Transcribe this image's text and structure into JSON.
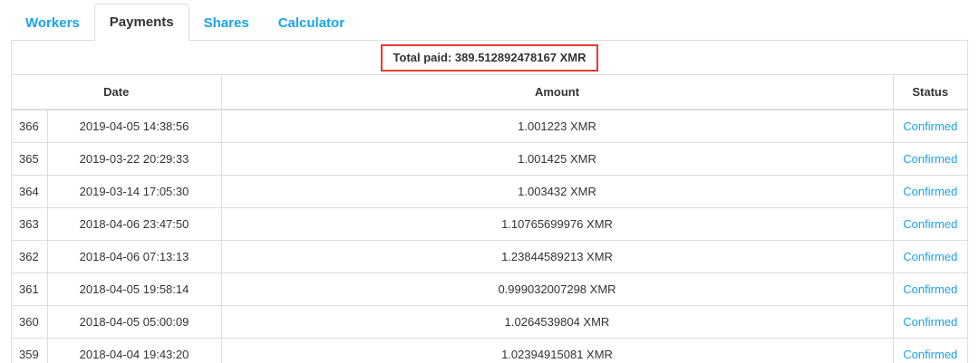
{
  "tabs": [
    {
      "label": "Workers",
      "active": false
    },
    {
      "label": "Payments",
      "active": true
    },
    {
      "label": "Shares",
      "active": false
    },
    {
      "label": "Calculator",
      "active": false
    }
  ],
  "total_paid": "Total paid: 389.512892478167 XMR",
  "table": {
    "headers": {
      "date": "Date",
      "amount": "Amount",
      "status": "Status"
    },
    "rows": [
      {
        "id": "366",
        "date": "2019-04-05 14:38:56",
        "amount": "1.001223 XMR",
        "status": "Confirmed"
      },
      {
        "id": "365",
        "date": "2019-03-22 20:29:33",
        "amount": "1.001425 XMR",
        "status": "Confirmed"
      },
      {
        "id": "364",
        "date": "2019-03-14 17:05:30",
        "amount": "1.003432 XMR",
        "status": "Confirmed"
      },
      {
        "id": "363",
        "date": "2018-04-06 23:47:50",
        "amount": "1.10765699976 XMR",
        "status": "Confirmed"
      },
      {
        "id": "362",
        "date": "2018-04-06 07:13:13",
        "amount": "1.23844589213 XMR",
        "status": "Confirmed"
      },
      {
        "id": "361",
        "date": "2018-04-05 19:58:14",
        "amount": "0.999032007298 XMR",
        "status": "Confirmed"
      },
      {
        "id": "360",
        "date": "2018-04-05 05:00:09",
        "amount": "1.0264539804 XMR",
        "status": "Confirmed"
      },
      {
        "id": "359",
        "date": "2018-04-04 19:43:20",
        "amount": "1.02394915081 XMR",
        "status": "Confirmed"
      }
    ]
  },
  "colors": {
    "link": "#1aa3e8",
    "highlight_border": "#e53935",
    "border": "#dddddd",
    "text": "#333333"
  }
}
